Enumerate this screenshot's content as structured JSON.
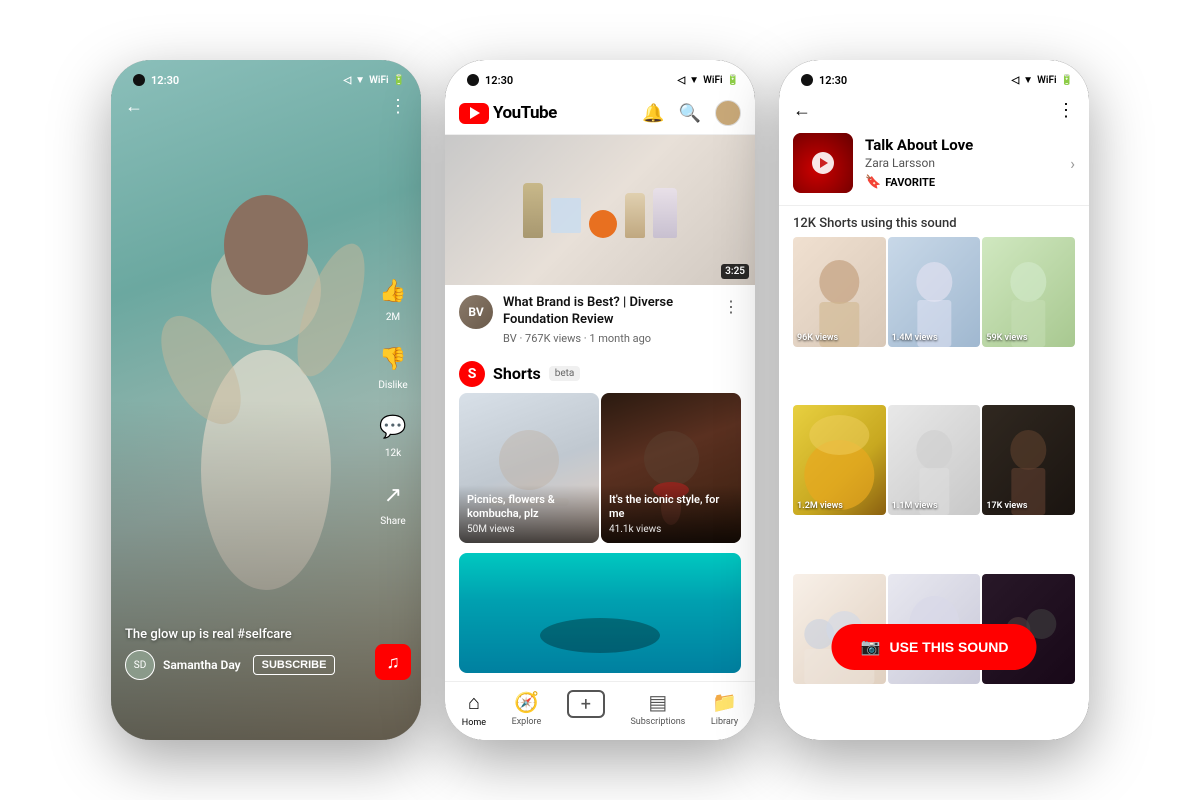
{
  "phone1": {
    "status_time": "12:30",
    "caption": "The glow up is real #selfcare",
    "channel_name": "Samantha Day",
    "channel_initials": "SD",
    "subscribe_label": "SUBSCRIBE",
    "likes": "2M",
    "dislike_label": "Dislike",
    "comments": "12k",
    "share_label": "Share",
    "music_icon": "♫"
  },
  "phone2": {
    "status_time": "12:30",
    "logo_text": "YouTube",
    "video_title": "What Brand is Best? | Diverse Foundation Review",
    "channel_abbr": "BV",
    "video_meta": "BV · 767K views · 1 month ago",
    "duration": "3:25",
    "shorts_label": "Shorts",
    "shorts_beta": "beta",
    "short1_title": "Picnics, flowers & kombucha, plz",
    "short1_views": "50M views",
    "short2_title": "It's the iconic style, for me",
    "short2_views": "41.1k views",
    "nav_home": "Home",
    "nav_explore": "Explore",
    "nav_subscriptions": "Subscriptions",
    "nav_library": "Library"
  },
  "phone3": {
    "status_time": "12:30",
    "song_title": "Talk About Love",
    "artist": "Zara Larsson",
    "favorite_label": "FAVORITE",
    "sound_count": "12K Shorts using this sound",
    "use_sound_label": "USE THIS SOUND",
    "videos": [
      {
        "views": "96K views",
        "bg": "sg1"
      },
      {
        "views": "1.4M views",
        "bg": "sg2"
      },
      {
        "views": "59K views",
        "bg": "sg3"
      },
      {
        "views": "1.2M views",
        "bg": "sg4"
      },
      {
        "views": "1.1M views",
        "bg": "sg5"
      },
      {
        "views": "17K views",
        "bg": "sg6"
      },
      {
        "views": "",
        "bg": "sg7"
      },
      {
        "views": "",
        "bg": "sg8"
      },
      {
        "views": "",
        "bg": "sg9"
      }
    ]
  }
}
